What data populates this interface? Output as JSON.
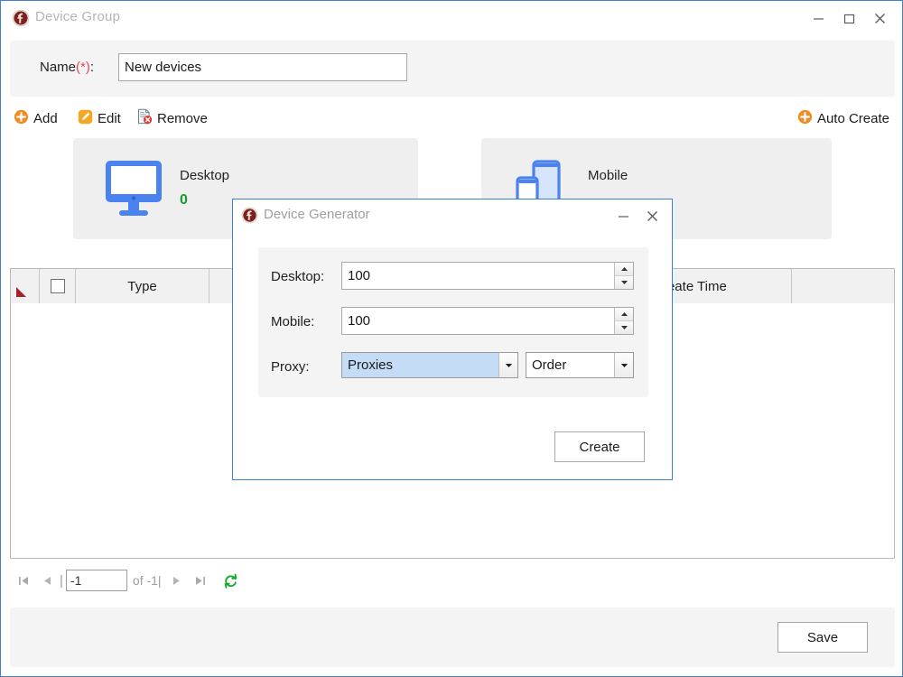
{
  "window": {
    "title": "Device Group",
    "app_icon": "app-logo-icon",
    "controls": {
      "minimize": "minimize-icon",
      "maximize": "maximize-icon",
      "close": "close-icon"
    }
  },
  "form": {
    "name_label": "Name(*):",
    "name_label_text": "Name",
    "name_required_mark": "(*)",
    "name_value": "New devices",
    "name_placeholder": ""
  },
  "toolbar": {
    "add_label": "Add",
    "edit_label": "Edit",
    "remove_label": "Remove",
    "auto_create_label": "Auto Create"
  },
  "cards": [
    {
      "title": "Desktop",
      "count": "0",
      "icon": "desktop-monitor-icon"
    },
    {
      "title": "Mobile",
      "count": "",
      "icon": "mobile-devices-icon"
    }
  ],
  "table": {
    "columns": [
      "",
      "",
      "Type",
      "",
      "",
      "Create Time",
      ""
    ],
    "type_header": "Type",
    "create_time_header": "Create Time",
    "rows": []
  },
  "pager": {
    "first_label": "first-page-icon",
    "prev_label": "previous-page-icon",
    "page_value": "-1",
    "of_text": "of -1|",
    "next_label": "next-page-icon",
    "last_label": "last-page-icon",
    "refresh_label": "refresh-icon"
  },
  "footer": {
    "save_label": "Save"
  },
  "dialog": {
    "title": "Device Generator",
    "app_icon": "app-logo-icon",
    "controls": {
      "minimize": "minimize-icon",
      "close": "close-icon"
    },
    "desktop_label": "Desktop:",
    "desktop_value": "100",
    "mobile_label": "Mobile:",
    "mobile_value": "100",
    "proxy_label": "Proxy:",
    "proxy_value": "Proxies",
    "proxy_options": [
      "Proxies"
    ],
    "order_value": "Order",
    "order_options": [
      "Order"
    ],
    "create_label": "Create"
  },
  "colors": {
    "window_border": "#3f7fd0",
    "accent_orange": "#f08c21",
    "count_green": "#1a9a2e",
    "required_red": "#e8465e",
    "marker_red": "#a3232b",
    "device_blue": "#4a82f0",
    "panel_gray": "#f4f4f4",
    "card_gray": "#efefef",
    "select_highlight": "#c5dcf7"
  }
}
